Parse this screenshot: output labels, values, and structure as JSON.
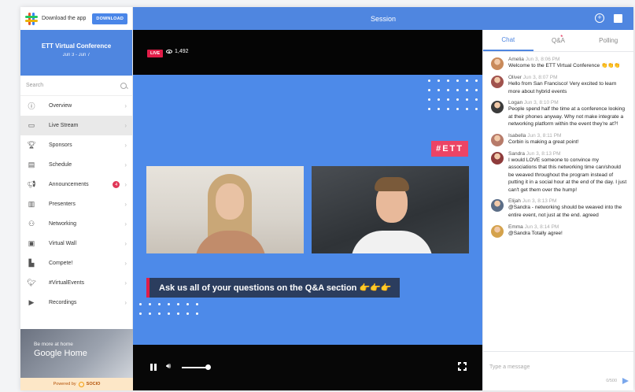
{
  "download_bar": {
    "text": "Download the app",
    "button": "DOWNLOAD"
  },
  "event": {
    "title": "ETT Virtual Conference",
    "dates": "Jun 3 - Jun 7"
  },
  "search": {
    "placeholder": "Search"
  },
  "sidebar": {
    "items": [
      {
        "label": "Overview",
        "icon": "info-icon"
      },
      {
        "label": "Live Stream",
        "icon": "tv-icon"
      },
      {
        "label": "Sponsors",
        "icon": "trophy-icon"
      },
      {
        "label": "Schedule",
        "icon": "calendar-icon"
      },
      {
        "label": "Announcements",
        "icon": "megaphone-icon",
        "badge": "4"
      },
      {
        "label": "Presenters",
        "icon": "presenter-icon"
      },
      {
        "label": "Networking",
        "icon": "network-icon"
      },
      {
        "label": "Virtual Wall",
        "icon": "wall-icon"
      },
      {
        "label": "Compete!",
        "icon": "leaderboard-icon"
      },
      {
        "label": "#VirtualEvents",
        "icon": "twitter-icon"
      },
      {
        "label": "Recordings",
        "icon": "recording-icon"
      }
    ],
    "active_index": 1
  },
  "promo": {
    "subtitle": "Be more at home",
    "title": "Google Home"
  },
  "powered_by": {
    "prefix": "Powered by",
    "brand": "SOCIO"
  },
  "session": {
    "title": "Session"
  },
  "video": {
    "live_label": "LIVE",
    "viewers": "1,492",
    "hashtag": "#ETT",
    "question_banner": "Ask us all of your questions on the Q&A section 👉👉👉",
    "volume_level": 0.9
  },
  "chat_tabs": [
    {
      "label": "Chat",
      "active": true
    },
    {
      "label": "Q&A",
      "active": false,
      "notification": "*"
    },
    {
      "label": "Polling",
      "active": false
    }
  ],
  "messages": [
    {
      "name": "Amelia",
      "time": "Jun 3, 8:06 PM",
      "text": "Welcome to the ETT Virtual Conference 👏👏👏",
      "avatar_color": "#c98a5a"
    },
    {
      "name": "Oliver",
      "time": "Jun 3, 8:07 PM",
      "text": "Hello from San Francisco! Very excited to learn more about hybrid events",
      "avatar_color": "#a0524d"
    },
    {
      "name": "Logan",
      "time": "Jun 3, 8:10 PM",
      "text": "People spend half the time at a conference looking at their phones anyway. Why not make integrate a networking platform within the event they're at?!",
      "avatar_color": "#3b3b3b"
    },
    {
      "name": "Isabella",
      "time": "Jun 3, 8:11 PM",
      "text": "Corbin is making a great point!",
      "avatar_color": "#b77b6a"
    },
    {
      "name": "Sandra",
      "time": "Jun 3, 8:13 PM",
      "text": "I would LOVE someone to convince my associations that this networking time can/should be weaved throughout the program instead of putting it in a social hour at the end of the day. I just can't get them over the hump!",
      "avatar_color": "#8e3b3b"
    },
    {
      "name": "Elijah",
      "time": "Jun 3, 8:13 PM",
      "text": "@Sandra - networking should be weaved into the entire event, not just at the end. agreed",
      "avatar_color": "#5b6d86"
    },
    {
      "name": "Emma",
      "time": "Jun 3, 8:14 PM",
      "text": "@Sandra Totally agree!",
      "avatar_color": "#d4a24c"
    }
  ],
  "chat_input": {
    "placeholder": "Type a message",
    "counter": "0/500"
  },
  "colors": {
    "accent": "#4f86e0",
    "live": "#e11d48",
    "hashtag_bg": "#ec4465",
    "stage_bg": "#4d8ae9"
  }
}
